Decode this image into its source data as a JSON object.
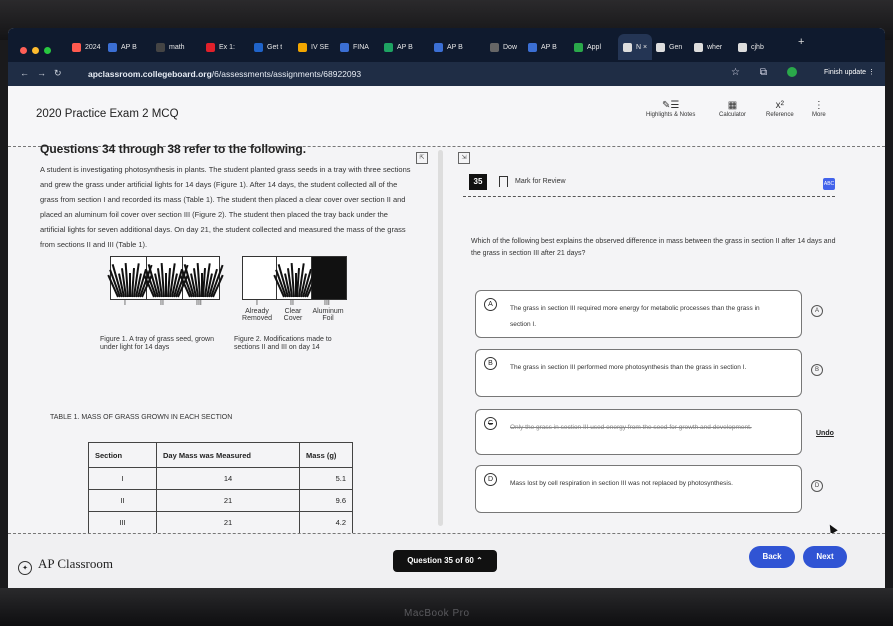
{
  "browser": {
    "tabs": [
      {
        "label": "2024",
        "color": "#ff5a4f"
      },
      {
        "label": "AP B",
        "color": "#3b6fd4"
      },
      {
        "label": "math",
        "color": "#444"
      },
      {
        "label": "Ex 1:",
        "color": "#e0202a"
      },
      {
        "label": "Get t",
        "color": "#1f63c9"
      },
      {
        "label": "IV SE",
        "color": "#f2a600"
      },
      {
        "label": "FINA",
        "color": "#3b6fd4"
      },
      {
        "label": "AP B",
        "color": "#1ea362"
      },
      {
        "label": "AP B",
        "color": "#3b6fd4"
      },
      {
        "label": "Dow",
        "color": "#666"
      },
      {
        "label": "AP B",
        "color": "#3b6fd4"
      },
      {
        "label": "Appl",
        "color": "#2aa84a"
      },
      {
        "label": "N ×",
        "color": "#ddd"
      },
      {
        "label": "Gen",
        "color": "#ddd"
      },
      {
        "label": "wher",
        "color": "#ddd"
      },
      {
        "label": "cjhb",
        "color": "#ddd"
      }
    ],
    "url_site": "apclassroom.collegeboard.org",
    "url_path": "/6/assessments/assignments/68922093",
    "finish_update": "Finish update"
  },
  "header": {
    "exam_title": "2020 Practice Exam 2 MCQ",
    "tools": [
      "Highlights & Notes",
      "Calculator",
      "Reference",
      "More"
    ]
  },
  "stimulus": {
    "heading": "Questions 34 through 38 refer to the following.",
    "passage": "A student is investigating photosynthesis in plants. The student planted grass seeds in a tray with three sections and grew the grass under artificial lights for 14 days (Figure 1). After 14 days, the student collected all of the grass from section I and recorded its mass (Table 1). The student then placed a clear cover over section II and placed an aluminum foil cover over section III (Figure 2). The student then placed the tray back under the artificial lights for seven additional days. On day 21, the student collected and measured the mass of the grass from sections II and III (Table 1).",
    "figure1": {
      "section_labels": [
        "I",
        "II",
        "III"
      ],
      "caption": "Figure 1. A tray of grass seed, grown under light for 14 days"
    },
    "figure2": {
      "section_labels": [
        "I",
        "II",
        "III"
      ],
      "sub_labels": [
        "Already Removed",
        "Clear Cover",
        "Aluminum Foil"
      ],
      "caption": "Figure 2. Modifications made to sections II and III on day 14"
    },
    "table_title": "TABLE 1. MASS OF GRASS GROWN IN EACH SECTION",
    "table_headers": [
      "Section",
      "Day Mass was Measured",
      "Mass (g)"
    ],
    "table_rows": [
      [
        "I",
        "14",
        "5.1"
      ],
      [
        "II",
        "21",
        "9.6"
      ],
      [
        "III",
        "21",
        "4.2"
      ]
    ]
  },
  "question": {
    "number": "35",
    "mark_for_review": "Mark for Review",
    "stem": "Which of the following best explains the observed difference in mass between the grass in section II after 14 days and the grass in section III after 21 days?",
    "options": [
      {
        "letter": "A",
        "text": "The grass in section III required more energy for metabolic processes than the grass in section I.",
        "crossed": false
      },
      {
        "letter": "B",
        "text": "The grass in section III performed more photosynthesis than the grass in section I.",
        "crossed": false
      },
      {
        "letter": "C",
        "text": "Only the grass in section III used energy from the seed for growth and development.",
        "crossed": true
      },
      {
        "letter": "D",
        "text": "Mass lost by cell respiration in section III was not replaced by photosynthesis.",
        "crossed": false
      }
    ],
    "undo": "Undo"
  },
  "footer": {
    "logo": "AP Classroom",
    "question_nav": "Question 35 of 60",
    "back": "Back",
    "next": "Next"
  },
  "device_brand": "MacBook Pro"
}
